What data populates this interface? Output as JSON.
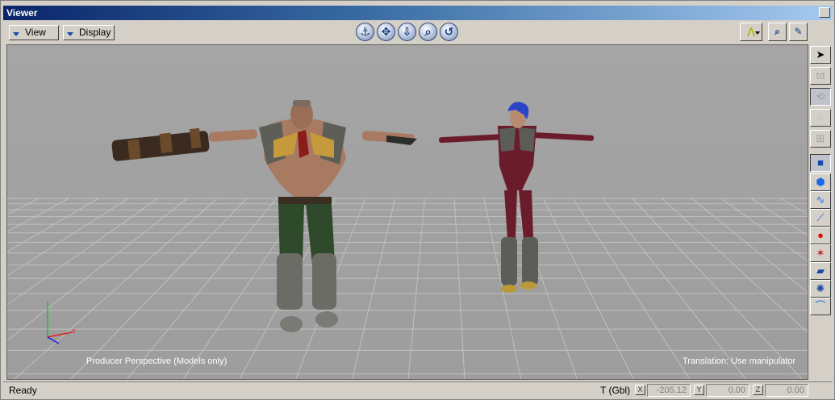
{
  "window": {
    "title": "Viewer"
  },
  "toolbar": {
    "view_label": "View",
    "display_label": "Display",
    "nav_icons": [
      "orbit-icon",
      "pan-icon",
      "dolly-icon",
      "zoom-icon",
      "rotate-view-icon"
    ],
    "right_tools": [
      "curve-icon",
      "zoom-2d-icon",
      "pen-icon"
    ]
  },
  "viewport": {
    "camera_label": "Producer Perspective (Models only)",
    "mode_label": "Translation: Use manipulator",
    "background_color": "#a3a3a3",
    "characters": [
      {
        "name": "male-cyborg-character",
        "colors": {
          "skin": "#a87a62",
          "pants": "#2f4a2a",
          "armor": "#6c6c66"
        }
      },
      {
        "name": "female-character",
        "colors": {
          "hair": "#2a44c8",
          "suit": "#6b1c2a",
          "armor": "#5c5c58"
        }
      }
    ]
  },
  "side_toolbar": {
    "tools": [
      "select-arrow-icon",
      "text-tool-icon",
      "rotate-tool-icon",
      "circle-tool-icon",
      "scale-tool-icon",
      "object-select-icon",
      "cube-icon",
      "curve-draw-icon",
      "line-draw-icon",
      "record-icon",
      "null-icon",
      "camera-icon",
      "light-icon",
      "bend-icon"
    ]
  },
  "statusbar": {
    "status": "Ready",
    "coord_label": "T (Gbl)",
    "x_tag": "X",
    "x_value": "-205.12",
    "y_tag": "Y",
    "y_value": "0.00",
    "z_tag": "Z",
    "z_value": "0.00"
  }
}
